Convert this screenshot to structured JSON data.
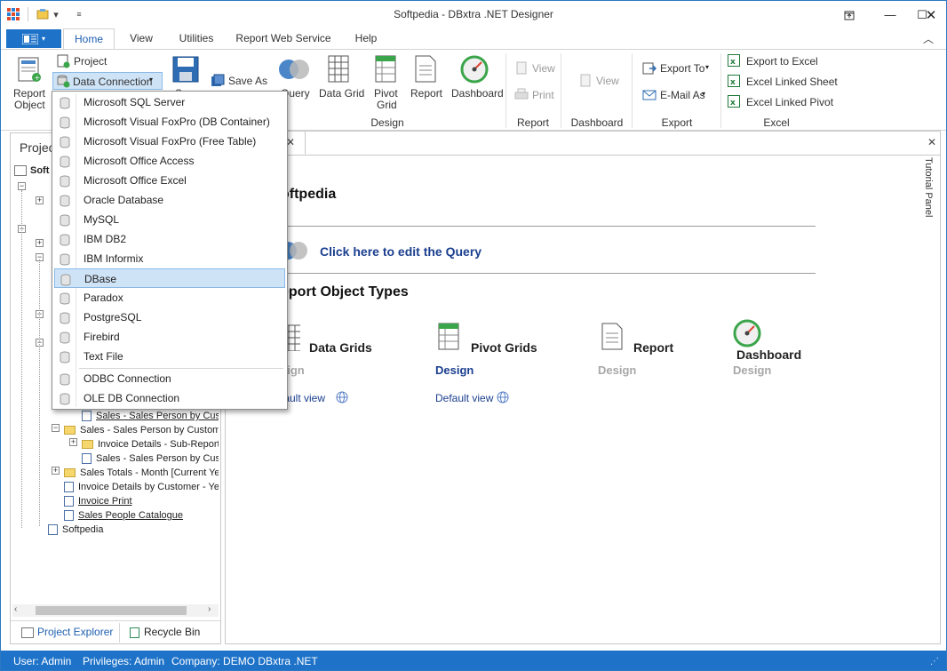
{
  "window": {
    "title": "Softpedia - DBxtra .NET Designer"
  },
  "tabs": [
    "Home",
    "View",
    "Utilities",
    "Report Web Service",
    "Help"
  ],
  "ribbon": {
    "report_object_l1": "Report",
    "report_object_l2": "Object",
    "project": "Project",
    "data_connection": "Data Connection",
    "save": "Save",
    "save_as": "Save As",
    "query": "Query",
    "data_grid": "Data Grid",
    "pivot_grid_l1": "Pivot",
    "pivot_grid_l2": "Grid",
    "report": "Report",
    "dashboard": "Dashboard",
    "view1": "View",
    "print": "Print",
    "view2": "View",
    "export_to": "Export To",
    "email_as": "E-Mail As",
    "export_to_excel": "Export to Excel",
    "excel_linked_sheet": "Excel Linked Sheet",
    "excel_linked_pivot": "Excel Linked Pivot",
    "groups": {
      "design": "Design",
      "report": "Report",
      "dashboard": "Dashboard",
      "export": "Export",
      "excel": "Excel"
    }
  },
  "left_panel": {
    "title": "Project",
    "tree": [
      "Soft",
      "Sales - Sales Person by Cust",
      "Sales - Sales Person by Custome",
      "Invoice Details - Sub-Report",
      "Sales - Sales Person by Cust",
      "Sales Totals - Month [Current Ye",
      "Invoice Details by Customer - Ye",
      "Invoice Print",
      "Sales People Catalogue",
      "Softpedia"
    ],
    "bottom_tabs": [
      "Project Explorer",
      "Recycle Bin"
    ]
  },
  "document": {
    "heading": "oftpedia",
    "query_link": "Click here to edit the Query",
    "types_heading": "eport Object Types",
    "object_types": [
      {
        "name": "Data Grids",
        "design": "sign",
        "default_view": "fault view"
      },
      {
        "name": "Pivot Grids",
        "design": "Design",
        "default_view": "Default view"
      },
      {
        "name": "Report",
        "design": "Design"
      },
      {
        "name": "Dashboard",
        "design": "Design"
      }
    ]
  },
  "tutorial_panel": "Tutorial Panel",
  "dropdown": {
    "items": [
      "Microsoft SQL Server",
      "Microsoft Visual FoxPro (DB Container)",
      "Microsoft Visual FoxPro (Free Table)",
      "Microsoft Office Access",
      "Microsoft Office Excel",
      "Oracle Database",
      "MySQL",
      "IBM DB2",
      "IBM Informix",
      "DBase",
      "Paradox",
      "PostgreSQL",
      "Firebird",
      "Text File"
    ],
    "extra_items": [
      "ODBC Connection",
      "OLE DB Connection"
    ],
    "selected": "DBase"
  },
  "status": {
    "user": "User: Admin",
    "privileges": "Privileges: Admin",
    "company": "Company: DEMO DBxtra .NET"
  },
  "colors": {
    "accent": "#1e73c9",
    "selected_item": "#cfe3f7",
    "link": "#1b3f8f"
  }
}
